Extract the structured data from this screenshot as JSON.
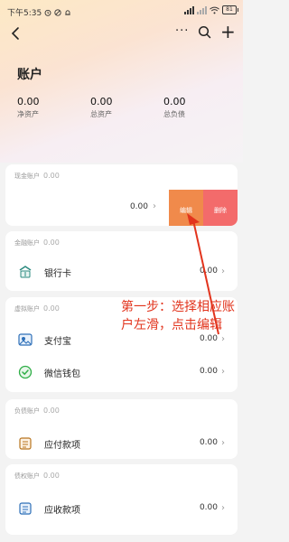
{
  "status_bar": {
    "time": "下午5:35",
    "battery": "81"
  },
  "nav": {
    "back_icon": "chevron-left-icon",
    "more_label": "···",
    "search_icon": "search-icon",
    "add_label": "+"
  },
  "page": {
    "title": "账户"
  },
  "summary": [
    {
      "value": "0.00",
      "label": "净资产"
    },
    {
      "value": "0.00",
      "label": "总资产"
    },
    {
      "value": "0.00",
      "label": "总负债"
    }
  ],
  "groups": {
    "cash": {
      "header": "现金账户",
      "total": "0.00",
      "row_value": "0.00",
      "edit_label": "编辑",
      "delete_label": "删除",
      "edit_color": "#f08a4b",
      "delete_color": "#f36b6b"
    },
    "finance": {
      "header": "金融账户",
      "total": "0.00",
      "rows": [
        {
          "label": "银行卡",
          "value": "0.00",
          "icon": "bank-card-icon"
        }
      ]
    },
    "virtual": {
      "header": "虚拟账户",
      "total": "0.00",
      "rows": [
        {
          "label": "支付宝",
          "value": "0.00",
          "icon": "alipay-icon"
        },
        {
          "label": "微信钱包",
          "value": "0.00",
          "icon": "wechat-wallet-icon"
        }
      ]
    },
    "liability": {
      "header": "负债账户",
      "total": "0.00",
      "rows": [
        {
          "label": "应付款项",
          "value": "0.00",
          "icon": "payable-icon"
        }
      ]
    },
    "credit": {
      "header": "债权账户",
      "total": "0.00",
      "rows": [
        {
          "label": "应收款项",
          "value": "0.00",
          "icon": "receivable-icon"
        }
      ]
    }
  },
  "annotation": {
    "text": "第一步：选择相应账户左滑，点击编辑",
    "color": "#e2341d"
  }
}
